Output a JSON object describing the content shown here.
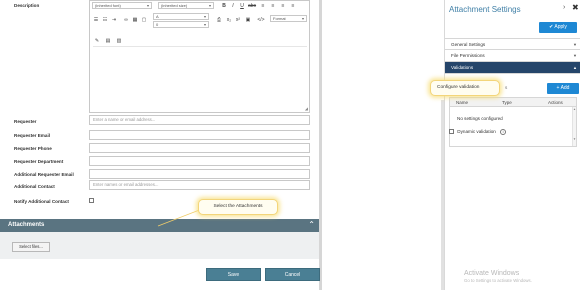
{
  "form": {
    "description_label": "Description",
    "toolbar": {
      "font_family": "(inherited font)",
      "font_size": "(inherited size)",
      "line_height": "A",
      "indent": "0",
      "format": "Format",
      "bold": "B",
      "italic": "I",
      "underline": "U",
      "source": "</>"
    },
    "fields": [
      {
        "label": "Requester",
        "placeholder": "Enter a name or email address..."
      },
      {
        "label": "Requester Email",
        "placeholder": ""
      },
      {
        "label": "Requester Phone",
        "placeholder": ""
      },
      {
        "label": "Requester Department",
        "placeholder": ""
      },
      {
        "label": "Additional Requester Email",
        "placeholder": ""
      },
      {
        "label": "Additional Contact",
        "placeholder": "Enter names or email addresses..."
      },
      {
        "label": "Notify Additional Contact",
        "placeholder": ""
      }
    ]
  },
  "attachments": {
    "title": "Attachments",
    "select_files": "Select files..."
  },
  "footer": {
    "save": "Save",
    "cancel": "Cancel"
  },
  "callouts": {
    "select_attachments": "Select the Attachments",
    "configure_validation": "Configure validation"
  },
  "panel": {
    "title": "Attachment Settings",
    "apply": "Apply",
    "sections": [
      {
        "label": "General Settings"
      },
      {
        "label": "File Permissions"
      },
      {
        "label": "Validations"
      }
    ],
    "add": "Add",
    "table": {
      "columns": [
        "Name",
        "Type",
        "Actions"
      ],
      "empty": "No settings configured"
    },
    "dynamic_validation": "Dynamic validation"
  },
  "watermark": {
    "line1": "Activate Windows",
    "line2": "Go to Settings to activate Windows."
  },
  "colors": {
    "primary_blue": "#1e88d4",
    "section_active": "#25456a",
    "attach_bar": "#5a7481",
    "footer_button": "#4a7f94",
    "callout_glow": "#f7dd78"
  }
}
